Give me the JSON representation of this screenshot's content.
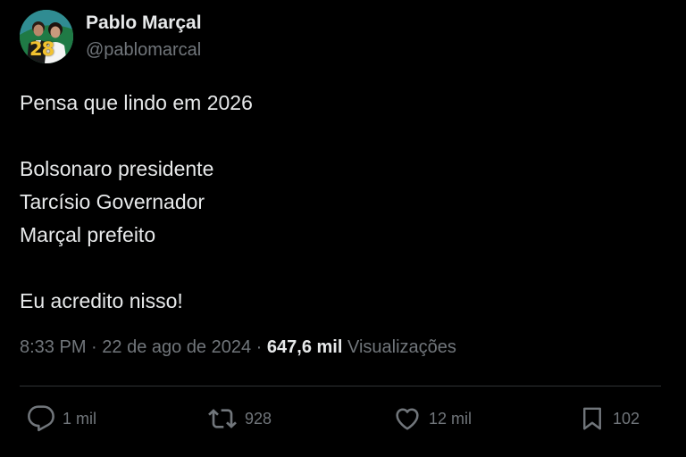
{
  "author": {
    "name": "Pablo Marçal",
    "handle": "@pablomarcal",
    "avatar_number": "28"
  },
  "tweet": {
    "lines": [
      "Pensa que lindo em 2026",
      "",
      "Bolsonaro presidente",
      "Tarcísio Governador",
      "Marçal prefeito",
      "",
      "Eu acredito nisso!"
    ]
  },
  "meta": {
    "time": "8:33 PM",
    "separator": "·",
    "date": "22 de ago de 2024",
    "views_count": "647,6 mil",
    "views_label": "Visualizações"
  },
  "actions": {
    "replies": "1 mil",
    "reposts": "928",
    "likes": "12 mil",
    "bookmarks": "102"
  },
  "icons": {
    "reply": "speech-bubble-icon",
    "repost": "repost-arrows-icon",
    "like": "heart-icon",
    "bookmark": "bookmark-icon"
  },
  "colors": {
    "background": "#000000",
    "text": "#e7e9ea",
    "muted": "#71767b",
    "divider": "#2f3336",
    "avatar_number": "#f2c230"
  }
}
